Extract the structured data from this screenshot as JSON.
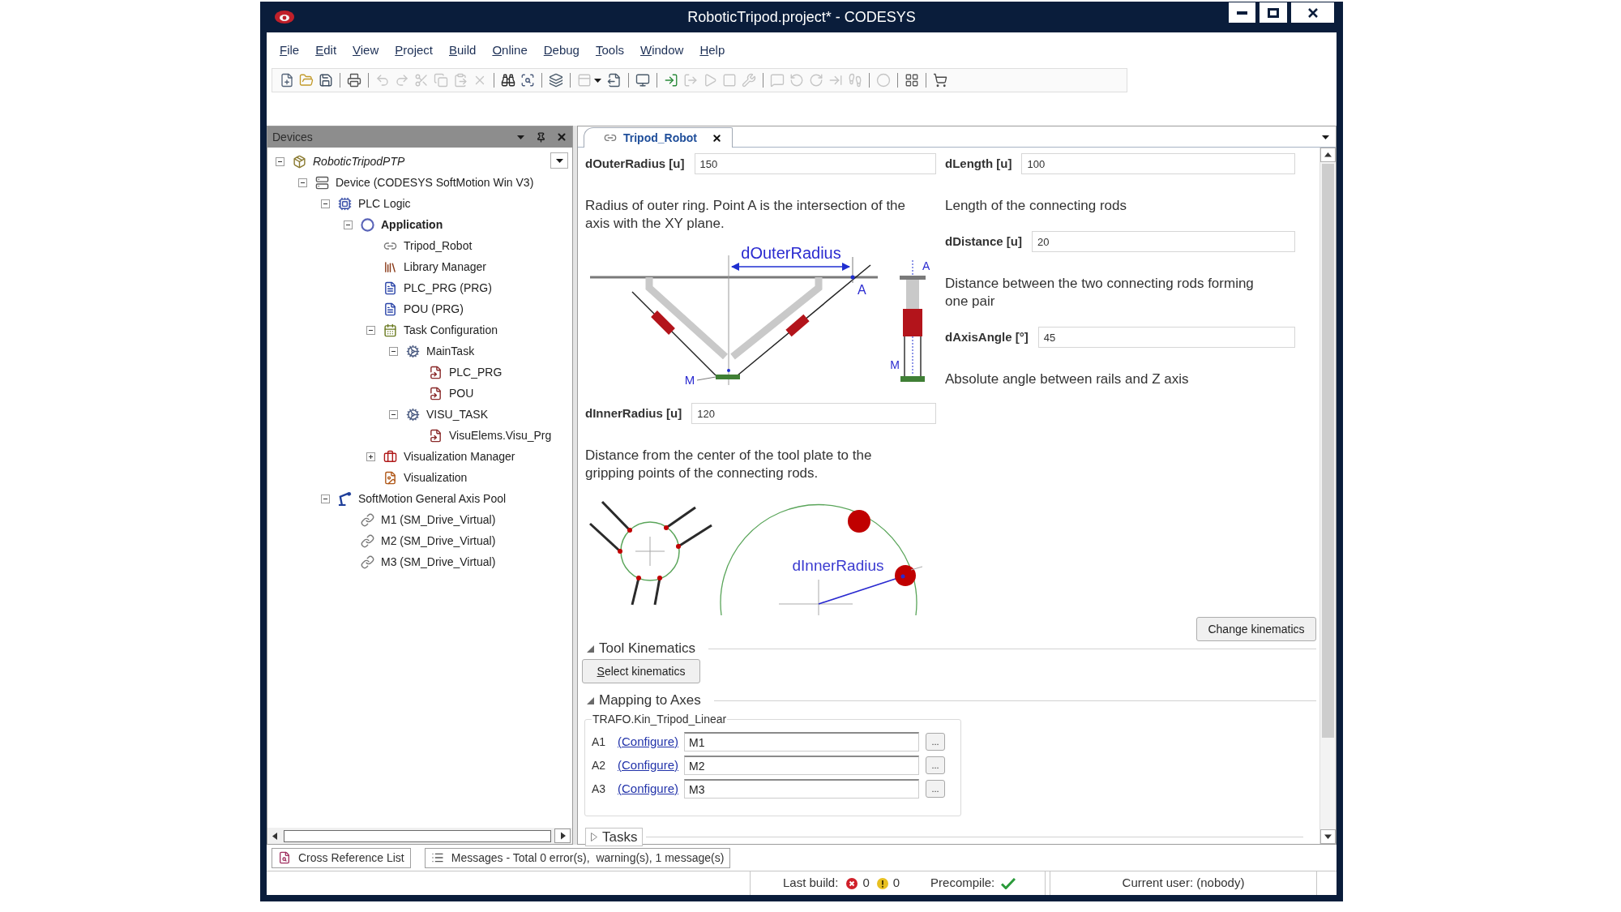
{
  "window": {
    "title": "RoboticTripod.project* - CODESYS"
  },
  "menu": [
    "File",
    "Edit",
    "View",
    "Project",
    "Build",
    "Online",
    "Debug",
    "Tools",
    "Window",
    "Help"
  ],
  "toolbar": [
    [
      {
        "disabled": false
      },
      {
        "disabled": false
      },
      {
        "disabled": false
      }
    ],
    [
      {
        "disabled": false
      }
    ],
    [
      {
        "disabled": true
      },
      {
        "disabled": true
      },
      {
        "disabled": true
      },
      {
        "disabled": true
      },
      {
        "disabled": true
      },
      {
        "disabled": true
      }
    ],
    [
      {
        "disabled": false
      },
      {
        "disabled": false
      }
    ],
    [
      {
        "disabled": false
      }
    ],
    [
      {
        "disabled": true
      },
      {
        "disabled": false
      }
    ],
    [
      {
        "disabled": false
      }
    ],
    [
      {
        "disabled": false
      },
      {
        "disabled": true
      },
      {
        "disabled": true
      },
      {
        "disabled": true
      },
      {
        "disabled": true
      }
    ],
    [
      {
        "disabled": true
      },
      {
        "disabled": true
      },
      {
        "disabled": true
      },
      {
        "disabled": true
      },
      {
        "disabled": true
      }
    ],
    [
      {
        "disabled": true
      }
    ],
    [
      {
        "disabled": false
      }
    ],
    [
      {
        "disabled": false
      }
    ]
  ],
  "devices": {
    "title": "Devices",
    "tree": [
      {
        "label": "RoboticTripodPTP",
        "kind": "project",
        "expanded": true,
        "children": [
          {
            "label": "Device (CODESYS SoftMotion Win V3)",
            "kind": "device",
            "expanded": true,
            "children": [
              {
                "label": "PLC Logic",
                "kind": "plc",
                "expanded": true,
                "children": [
                  {
                    "label": "Application",
                    "kind": "application",
                    "expanded": true,
                    "children": [
                      {
                        "label": "Tripod_Robot",
                        "kind": "kinematics"
                      },
                      {
                        "label": "Library Manager",
                        "kind": "library"
                      },
                      {
                        "label": "PLC_PRG (PRG)",
                        "kind": "program"
                      },
                      {
                        "label": "POU (PRG)",
                        "kind": "pou"
                      },
                      {
                        "label": "Task Configuration",
                        "kind": "taskconfig",
                        "expanded": true,
                        "children": [
                          {
                            "label": "MainTask",
                            "kind": "task",
                            "expanded": true,
                            "children": [
                              {
                                "label": "PLC_PRG",
                                "kind": "call"
                              },
                              {
                                "label": "POU",
                                "kind": "call"
                              }
                            ]
                          },
                          {
                            "label": "VISU_TASK",
                            "kind": "task",
                            "expanded": true,
                            "children": [
                              {
                                "label": "VisuElems.Visu_Prg",
                                "kind": "call"
                              }
                            ]
                          }
                        ]
                      },
                      {
                        "label": "Visualization Manager",
                        "kind": "visumanager",
                        "expanded": false
                      },
                      {
                        "label": "Visualization",
                        "kind": "visu"
                      }
                    ]
                  }
                ]
              },
              {
                "label": "SoftMotion General Axis Pool",
                "kind": "axispool",
                "expanded": true,
                "children": [
                  {
                    "label": "M1 (SM_Drive_Virtual)",
                    "kind": "axis"
                  },
                  {
                    "label": "M2 (SM_Drive_Virtual)",
                    "kind": "axis"
                  },
                  {
                    "label": "M3 (SM_Drive_Virtual)",
                    "kind": "axis"
                  }
                ]
              }
            ]
          }
        ]
      }
    ]
  },
  "editor": {
    "tabs": [
      {
        "label": "Tripod_Robot",
        "selected": true
      }
    ],
    "columns": [
      [
        {
          "label": "dOuterRadius [u]",
          "value": "150",
          "description": "Radius of outer ring. Point A is the intersection of the axis with the XY plane.",
          "figure": {
            "kind": "outer_radius",
            "dimension": "dOuterRadius",
            "point_a": "A",
            "point_m": "M",
            "side_a": "A",
            "side_m": "M"
          }
        },
        {
          "label": "dInnerRadius [u]",
          "value": "120",
          "description": "Distance from the center of the tool plate to the gripping points of the connecting rods.",
          "figure": {
            "kind": "inner_radius",
            "dimension": "dInnerRadius"
          }
        }
      ],
      [
        {
          "label": "dLength [u]",
          "value": "100",
          "description": "Length of the connecting rods"
        },
        {
          "label": "dDistance [u]",
          "value": "20",
          "description": "Distance between the two connecting rods forming one pair"
        },
        {
          "label": "dAxisAngle [°]",
          "value": "45",
          "description": "Absolute angle between rails and Z axis"
        }
      ]
    ],
    "change_button": "Change kinematics",
    "sections": [
      {
        "kind": "tool_kinematics",
        "title": "Tool Kinematics",
        "expanded": true,
        "button": "Select kinematics"
      },
      {
        "kind": "axis_mapping",
        "title": "Mapping to Axes",
        "expanded": true,
        "group": "TRAFO.Kin_Tripod_Linear",
        "rows": [
          {
            "axis": "A1",
            "link": "(Configure)",
            "value": "M1",
            "browse": "..."
          },
          {
            "axis": "A2",
            "link": "(Configure)",
            "value": "M2",
            "browse": "..."
          },
          {
            "axis": "A3",
            "link": "(Configure)",
            "value": "M3",
            "browse": "..."
          }
        ]
      },
      {
        "kind": "tasks",
        "title": "Tasks",
        "expanded": false
      }
    ]
  },
  "output_tabs": [
    {
      "label": "Cross Reference List",
      "selected": false
    },
    {
      "label": "Messages - Total 0 error(s),  warning(s), 1 message(s)",
      "selected": false
    }
  ],
  "status_bar": {
    "last_build": "Last build:",
    "errors": "0",
    "warnings": "0",
    "precompile": "Precompile:",
    "precompile_ok": true,
    "user": "Current user: (nobody)"
  }
}
